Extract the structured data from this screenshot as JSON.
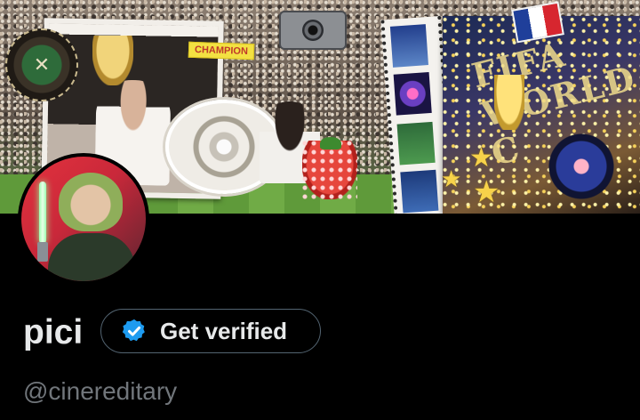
{
  "banner": {
    "champion_tag": "CHAMPION",
    "worldcup_text": "FIFA WORLD C",
    "flag_colors": [
      "#1f3f9a",
      "#ffffff",
      "#d7262f"
    ]
  },
  "profile": {
    "name": "pici",
    "handle": "@cinereditary",
    "verify_button_label": "Get verified",
    "verified_badge_color": "#1d9bf0"
  },
  "icons": {
    "verified": "verified-badge-icon",
    "camera": "camera-icon",
    "star": "star-icon",
    "tennis": "crossed-rackets-icon"
  }
}
